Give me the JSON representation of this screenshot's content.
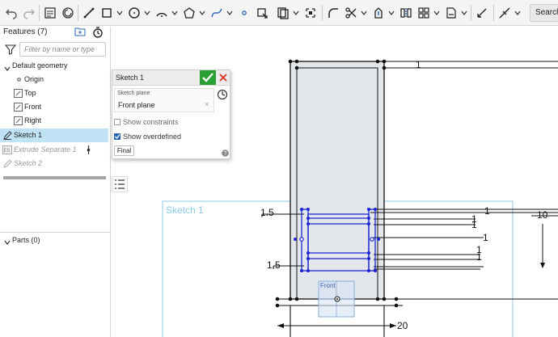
{
  "toolbar": {
    "search_label": "Search",
    "icons": [
      "undo-icon",
      "redo-icon",
      "sketch-icon",
      "extrude-icon",
      "line-icon",
      "rectangle-icon",
      "circle-icon",
      "arc-icon",
      "polygon-icon",
      "spline-icon",
      "point-icon",
      "use-icon",
      "offset-icon",
      "fillet-icon",
      "trim-icon",
      "transform-icon",
      "pattern-icon",
      "dimension-icon",
      "constraint-icon"
    ]
  },
  "features": {
    "title": "Features (7)",
    "filter_placeholder": "Filter by name or type",
    "default_geometry": "Default geometry",
    "items": [
      {
        "label": "Origin"
      },
      {
        "label": "Top"
      },
      {
        "label": "Front"
      },
      {
        "label": "Right"
      },
      {
        "label": "Sketch 1"
      },
      {
        "label": "Extrude Separate 1"
      },
      {
        "label": "Sketch 2"
      }
    ],
    "parts_label": "Parts (0)"
  },
  "sketch_dialog": {
    "title": "Sketch 1",
    "plane_label": "Sketch plane",
    "plane_value": "Front plane",
    "clear_glyph": "×",
    "show_constraints": "Show constraints",
    "show_constraints_checked": false,
    "show_overdefined": "Show overdefined",
    "show_overdefined_checked": true,
    "final_button": "Final"
  },
  "viewport": {
    "plane_name": "Sketch 1",
    "front_label": "Front",
    "dimensions": {
      "top_width": "1",
      "left_top_offset": "1.5",
      "right_top_1": "1",
      "right_top_2": "1",
      "right_top_3": "1",
      "right_mid": "1",
      "right_mid_2": "1",
      "height": "10",
      "right_low": "1",
      "left_low_offset": "1.5",
      "bottom_width": "20"
    }
  },
  "colors": {
    "accent_green": "#29a033",
    "cancel_red": "#d9452c",
    "selected_row": "#bfe3f4",
    "sketch_blue": "#1a24d4",
    "plane_outline": "#8cc8e6",
    "body_fill": "#e3e6ea"
  }
}
